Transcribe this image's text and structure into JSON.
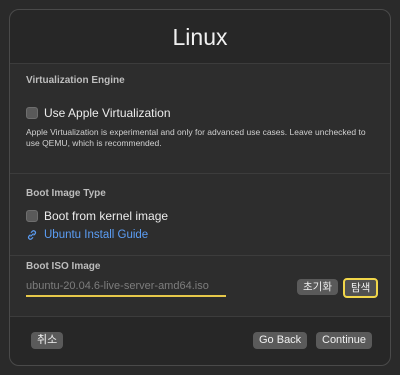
{
  "window": {
    "title": "Linux"
  },
  "virtualization": {
    "header": "Virtualization Engine",
    "checkbox_label": "Use Apple Virtualization",
    "checked": false,
    "description": "Apple Virtualization is experimental and only for advanced use cases. Leave unchecked to use QEMU, which is recommended."
  },
  "boot_image": {
    "header": "Boot Image Type",
    "checkbox_label": "Boot from kernel image",
    "checked": false,
    "link_label": "Ubuntu Install Guide",
    "link_icon": "link-icon"
  },
  "boot_iso": {
    "header": "Boot ISO Image",
    "file_name": "ubuntu-20.04.6-live-server-amd64.iso",
    "clear_label": "초기화",
    "browse_label": "탐색"
  },
  "footer": {
    "cancel_label": "취소",
    "back_label": "Go Back",
    "continue_label": "Continue"
  },
  "colors": {
    "accent_link": "#5b9df4",
    "highlight": "#f1d64a"
  }
}
